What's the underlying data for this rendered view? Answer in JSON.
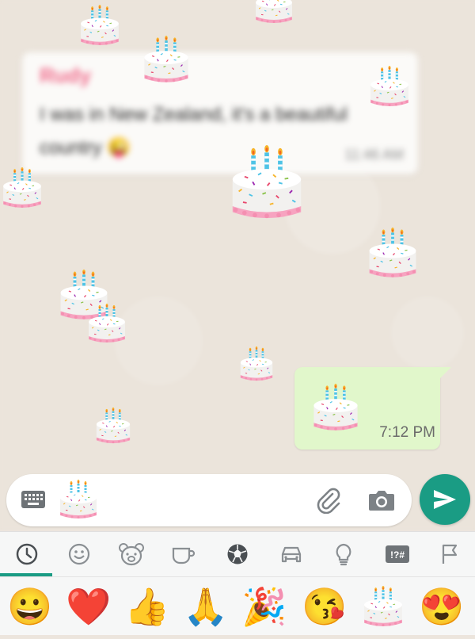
{
  "incoming_message": {
    "sender": "Rudy",
    "text": "I was in New Zealand, it's a beautiful country 😜",
    "time": "11:46 AM"
  },
  "outgoing_message": {
    "content": "birthday-cake-emoji",
    "time": "7:12 PM"
  },
  "composer": {
    "content": "birthday-cake-emoji",
    "icons": [
      "keyboard-icon",
      "paperclip-icon",
      "camera-icon",
      "send-icon"
    ]
  },
  "emoji_categories": [
    "recent",
    "smileys",
    "animals",
    "food",
    "activities",
    "travel",
    "objects",
    "symbols",
    "flags"
  ],
  "symbols_tab_label": "!?#",
  "recent_emojis": [
    "😀",
    "❤️",
    "👍",
    "🙏",
    "🎉",
    "😘",
    "birthday-cake",
    "😍"
  ],
  "colors": {
    "accent": "#1a9c84",
    "outgoing_bubble": "#e1f7cb",
    "chat_background": "#ebe4db",
    "sender_name": "#f06a8a"
  }
}
